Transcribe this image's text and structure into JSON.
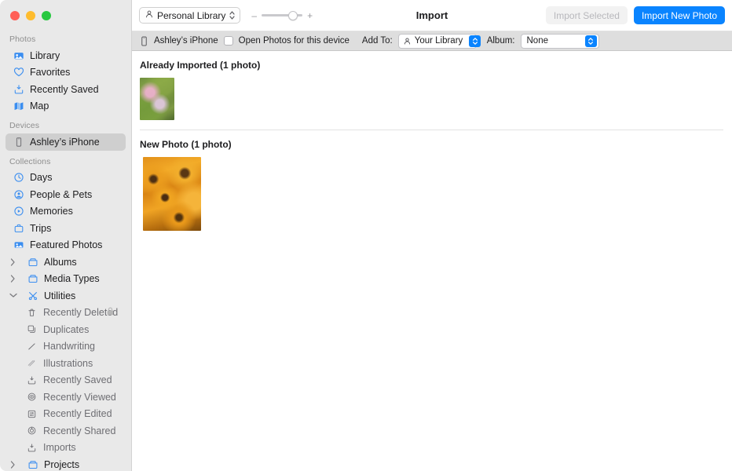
{
  "window": {
    "title": "Import",
    "traffic_lights": [
      "close",
      "minimize",
      "maximize"
    ]
  },
  "toolbar": {
    "library_popup": {
      "label": "Personal Library",
      "icon": "person-icon",
      "chevron": "chevron-up-down-icon"
    },
    "zoom": {
      "minus": "–",
      "plus": "+",
      "value_percent": 66
    },
    "import_selected_button": {
      "label": "Import Selected",
      "enabled": false
    },
    "import_new_button": {
      "label": "Import New Photo",
      "enabled": true,
      "color": "#0a84ff"
    }
  },
  "import_bar": {
    "device_icon": "iphone-icon",
    "device_name": "Ashley’s iPhone",
    "open_photos_checkbox": {
      "label": "Open Photos for this device",
      "checked": false
    },
    "add_to_label": "Add To:",
    "add_to_value": "Your Library",
    "add_to_icon": "person-icon",
    "album_label": "Album:",
    "album_value": "None"
  },
  "sidebar": {
    "sections": [
      {
        "title": "Photos",
        "items": [
          {
            "label": "Library",
            "icon": "photos-library-icon",
            "selected": false
          },
          {
            "label": "Favorites",
            "icon": "heart-icon",
            "selected": false
          },
          {
            "label": "Recently Saved",
            "icon": "tray-arrow-down-icon",
            "selected": false
          },
          {
            "label": "Map",
            "icon": "map-icon",
            "selected": false
          }
        ]
      },
      {
        "title": "Devices",
        "items": [
          {
            "label": "Ashley’s iPhone",
            "icon": "iphone-icon",
            "selected": true
          }
        ]
      },
      {
        "title": "Collections",
        "items": [
          {
            "label": "Days",
            "icon": "clock-icon",
            "selected": false
          },
          {
            "label": "People & Pets",
            "icon": "person-circle-icon",
            "selected": false
          },
          {
            "label": "Memories",
            "icon": "memories-play-icon",
            "selected": false
          },
          {
            "label": "Trips",
            "icon": "suitcase-icon",
            "selected": false
          },
          {
            "label": "Featured Photos",
            "icon": "featured-photo-icon",
            "selected": false
          },
          {
            "label": "Albums",
            "icon": "folder-icon",
            "selected": false,
            "twisty": "collapsed"
          },
          {
            "label": "Media Types",
            "icon": "folder-icon",
            "selected": false,
            "twisty": "collapsed"
          },
          {
            "label": "Utilities",
            "icon": "tools-icon",
            "selected": false,
            "twisty": "expanded"
          },
          {
            "label": "Recently Deleted",
            "icon": "trash-icon",
            "selected": false,
            "sub": true,
            "badge_icon": "lock-icon"
          },
          {
            "label": "Duplicates",
            "icon": "duplicates-icon",
            "selected": false,
            "sub": true
          },
          {
            "label": "Handwriting",
            "icon": "handwriting-icon",
            "selected": false,
            "sub": true
          },
          {
            "label": "Illustrations",
            "icon": "illustrations-icon",
            "selected": false,
            "sub": true
          },
          {
            "label": "Recently Saved",
            "icon": "tray-arrow-down-icon",
            "selected": false,
            "sub": true
          },
          {
            "label": "Recently Viewed",
            "icon": "eye-target-icon",
            "selected": false,
            "sub": true
          },
          {
            "label": "Recently Edited",
            "icon": "sliders-square-icon",
            "selected": false,
            "sub": true
          },
          {
            "label": "Recently Shared",
            "icon": "share-circle-icon",
            "selected": false,
            "sub": true
          },
          {
            "label": "Imports",
            "icon": "tray-arrow-down-icon",
            "selected": false,
            "sub": true
          },
          {
            "label": "Projects",
            "icon": "folder-icon",
            "selected": false,
            "twisty": "collapsed"
          }
        ]
      }
    ]
  },
  "content": {
    "sections": [
      {
        "header": "Already Imported (1 photo)",
        "photos": [
          {
            "alt": "pink cosmos flowers with green foliage",
            "size": "small"
          }
        ]
      },
      {
        "header": "New Photo (1 photo)",
        "photos": [
          {
            "alt": "orange black-eyed Susan flowers",
            "size": "large"
          }
        ]
      }
    ]
  }
}
